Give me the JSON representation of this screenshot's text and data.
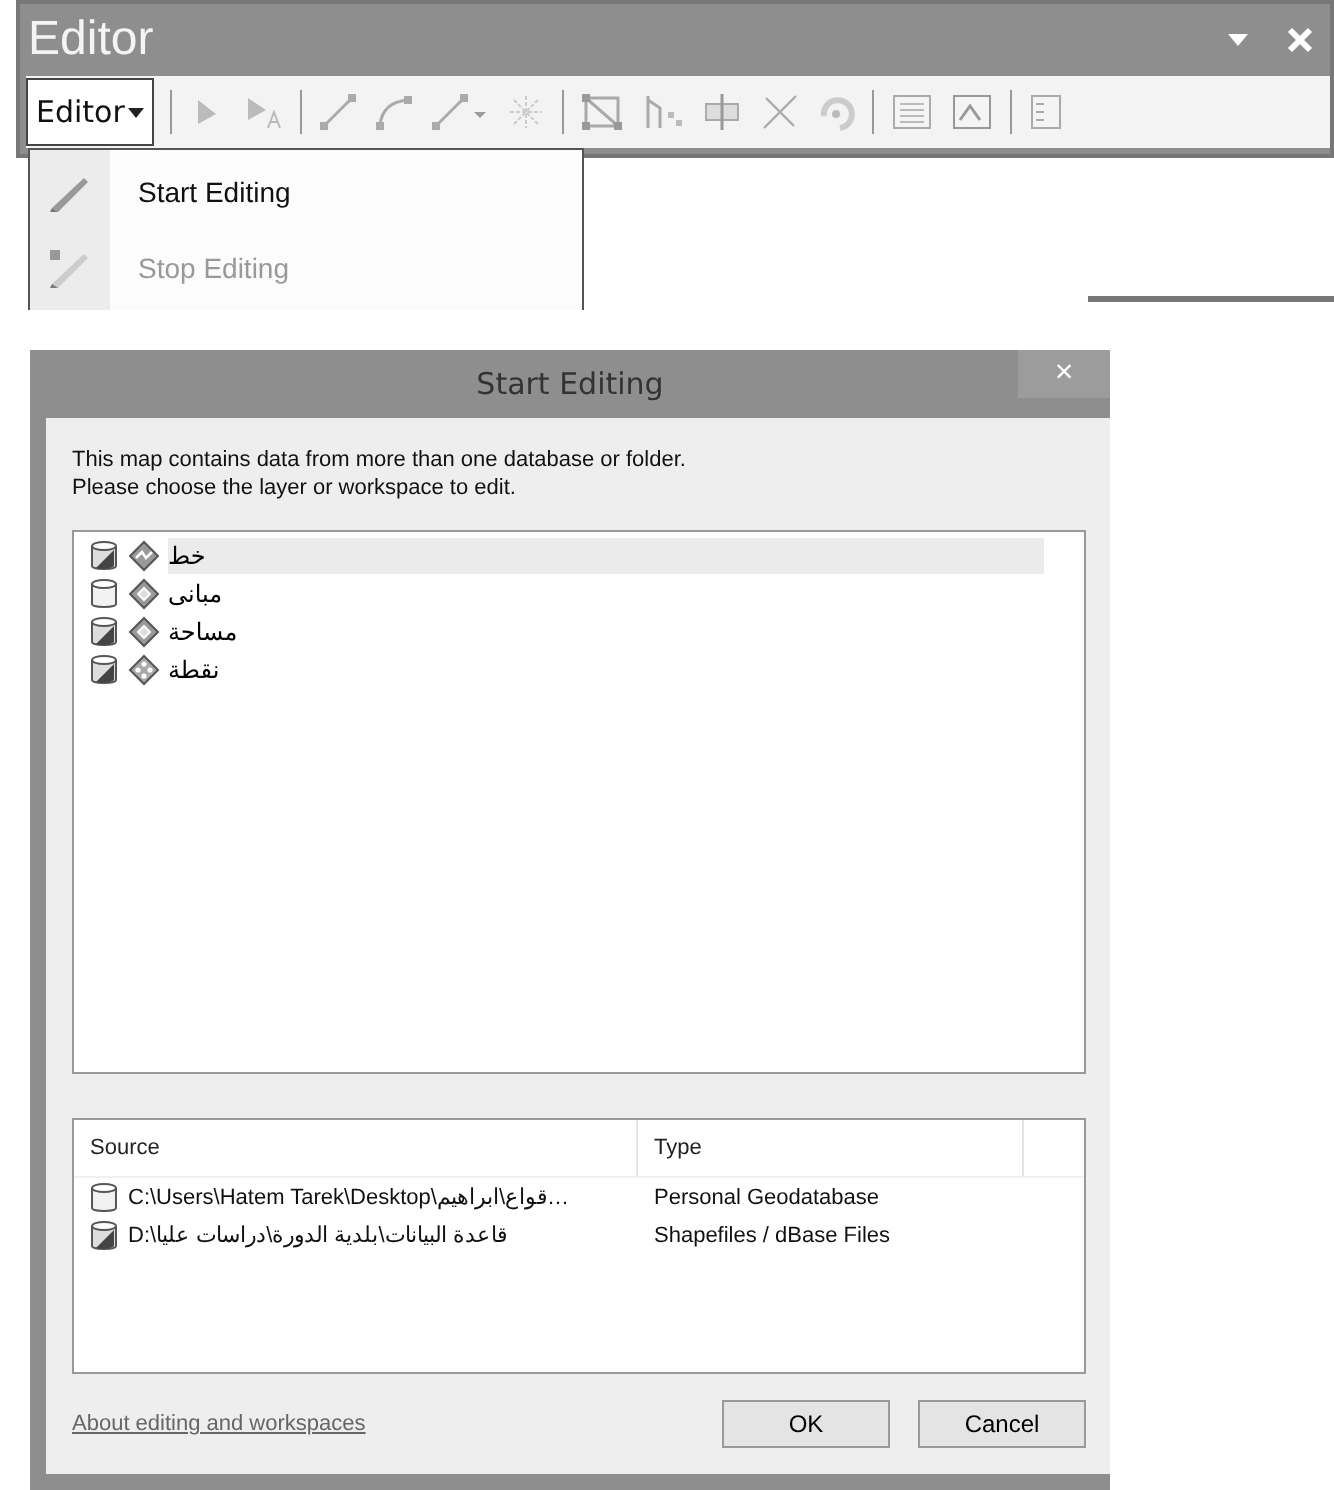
{
  "toolbar_window": {
    "title": "Editor",
    "menu_button": "Editor"
  },
  "menu": [
    {
      "label": "Start Editing",
      "disabled": false
    },
    {
      "label": "Stop Editing",
      "disabled": true
    }
  ],
  "dialog": {
    "title": "Start Editing",
    "close": "×",
    "message": "This map contains data from more than one database or folder.\nPlease choose the layer or workspace to edit.",
    "layers": [
      {
        "name": "خط",
        "icons": [
          {
            "kind": "shapefile"
          },
          {
            "kind": "line"
          }
        ],
        "selected": true
      },
      {
        "name": "مبانى",
        "icons": [
          {
            "kind": "geodatabase"
          },
          {
            "kind": "polygon"
          }
        ],
        "selected": false
      },
      {
        "name": "مساحة",
        "icons": [
          {
            "kind": "shapefile"
          },
          {
            "kind": "polygon"
          }
        ],
        "selected": false
      },
      {
        "name": "نقطة",
        "icons": [
          {
            "kind": "shapefile"
          },
          {
            "kind": "point"
          }
        ],
        "selected": false
      }
    ],
    "sources_table": {
      "columns": [
        "Source",
        "Type"
      ],
      "rows": [
        {
          "source": "C:\\Users\\Hatem Tarek\\Desktop\\قواع\\ابراهيم…",
          "type": "Personal Geodatabase",
          "kind": "geodatabase"
        },
        {
          "source": "D:\\قاعدة البيانات\\بلدية الدورة\\دراسات عليا",
          "type": "Shapefiles / dBase Files",
          "kind": "shapefile"
        }
      ]
    },
    "help_link": "About editing and workspaces",
    "buttons": [
      "OK",
      "Cancel"
    ]
  }
}
